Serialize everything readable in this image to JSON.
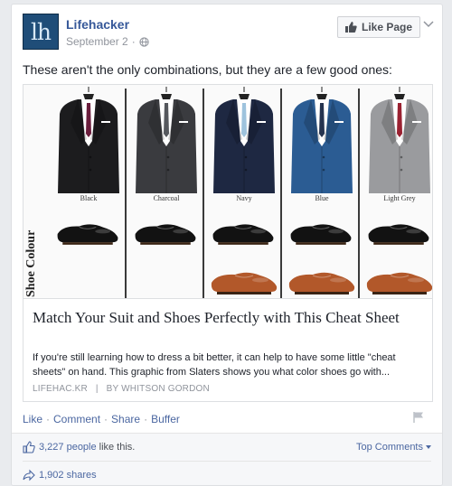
{
  "post": {
    "page_name": "Lifehacker",
    "avatar_text": "lh",
    "date": "September 2",
    "separator": "·",
    "like_page_label": "Like Page",
    "text": "These aren't the only combinations, but they are a few good ones:"
  },
  "link": {
    "image": {
      "side_label": "Shoe Colour",
      "suits": [
        {
          "name": "Black",
          "jacket": "#1c1c1e",
          "shirt": "#ffffff",
          "tie": "#6a1d3c"
        },
        {
          "name": "Charcoal",
          "jacket": "#3a3b3f",
          "shirt": "#ffffff",
          "tie": "#55585d"
        },
        {
          "name": "Navy",
          "jacket": "#1e2842",
          "shirt": "#ffffff",
          "tie": "#9ec3dd"
        },
        {
          "name": "Blue",
          "jacket": "#2b5c93",
          "shirt": "#ffffff",
          "tie": "#25334f"
        },
        {
          "name": "Light Grey",
          "jacket": "#9a9b9e",
          "shirt": "#ffffff",
          "tie": "#9a2131"
        }
      ],
      "shoe_colors": {
        "black": "#121212",
        "brown": "#b2582a"
      }
    },
    "title": "Match Your Suit and Shoes Perfectly with This Cheat Sheet",
    "description": "If you're still learning how to dress a bit better, it can help to have some little \"cheat sheets\" on hand. This graphic from Slaters shows you what color shoes go with...",
    "domain": "LIFEHAC.KR",
    "source_sep": "|",
    "byline": "BY WHITSON GORDON"
  },
  "actions": {
    "like": "Like",
    "comment": "Comment",
    "share": "Share",
    "buffer": "Buffer",
    "dot": "·"
  },
  "footer": {
    "likes_count": "3,227 people",
    "likes_suffix": "like this.",
    "top_comments": "Top Comments",
    "shares": "1,902 shares"
  },
  "colors": {
    "link": "#365899",
    "action": "#4b67a1",
    "muted": "#90949c"
  }
}
